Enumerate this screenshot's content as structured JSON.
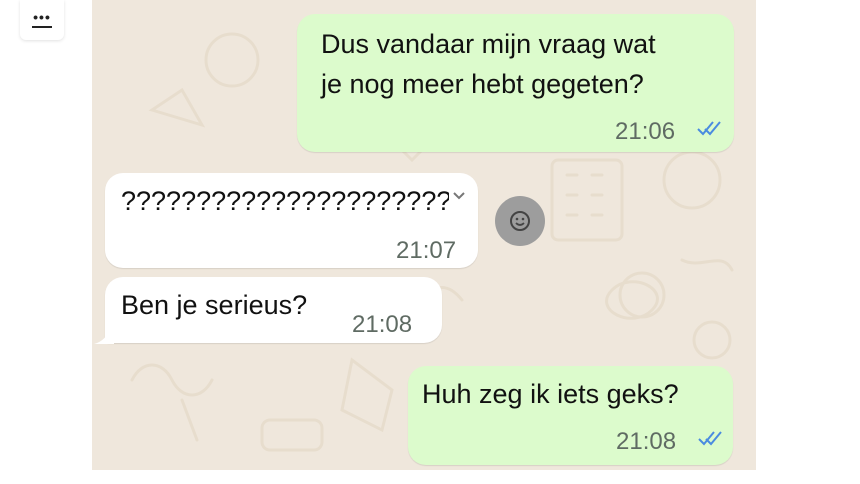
{
  "menu": {
    "icon": "more-menu-icon"
  },
  "messages": [
    {
      "direction": "outgoing",
      "text_lines": [
        "Dus vandaar mijn vraag wat",
        "je nog meer hebt gegeten?"
      ],
      "time": "21:06",
      "status_icon": "double-check-read-icon"
    },
    {
      "direction": "incoming",
      "text": "??????????????????????",
      "time": "21:07",
      "has_dropdown": true
    },
    {
      "direction": "incoming",
      "text": "Ben je serieus?",
      "time": "21:08"
    },
    {
      "direction": "outgoing",
      "text": "Huh zeg ik iets geks?",
      "time": "21:08",
      "status_icon": "double-check-read-icon"
    }
  ],
  "reaction_button": {
    "icon": "emoji-smile-icon"
  },
  "colors": {
    "chat_background": "#efe7dc",
    "outgoing_bubble": "#dcfbcc",
    "incoming_bubble": "#ffffff",
    "read_ticks": "#4a8be0",
    "reaction_button": "#9d9d9d"
  }
}
